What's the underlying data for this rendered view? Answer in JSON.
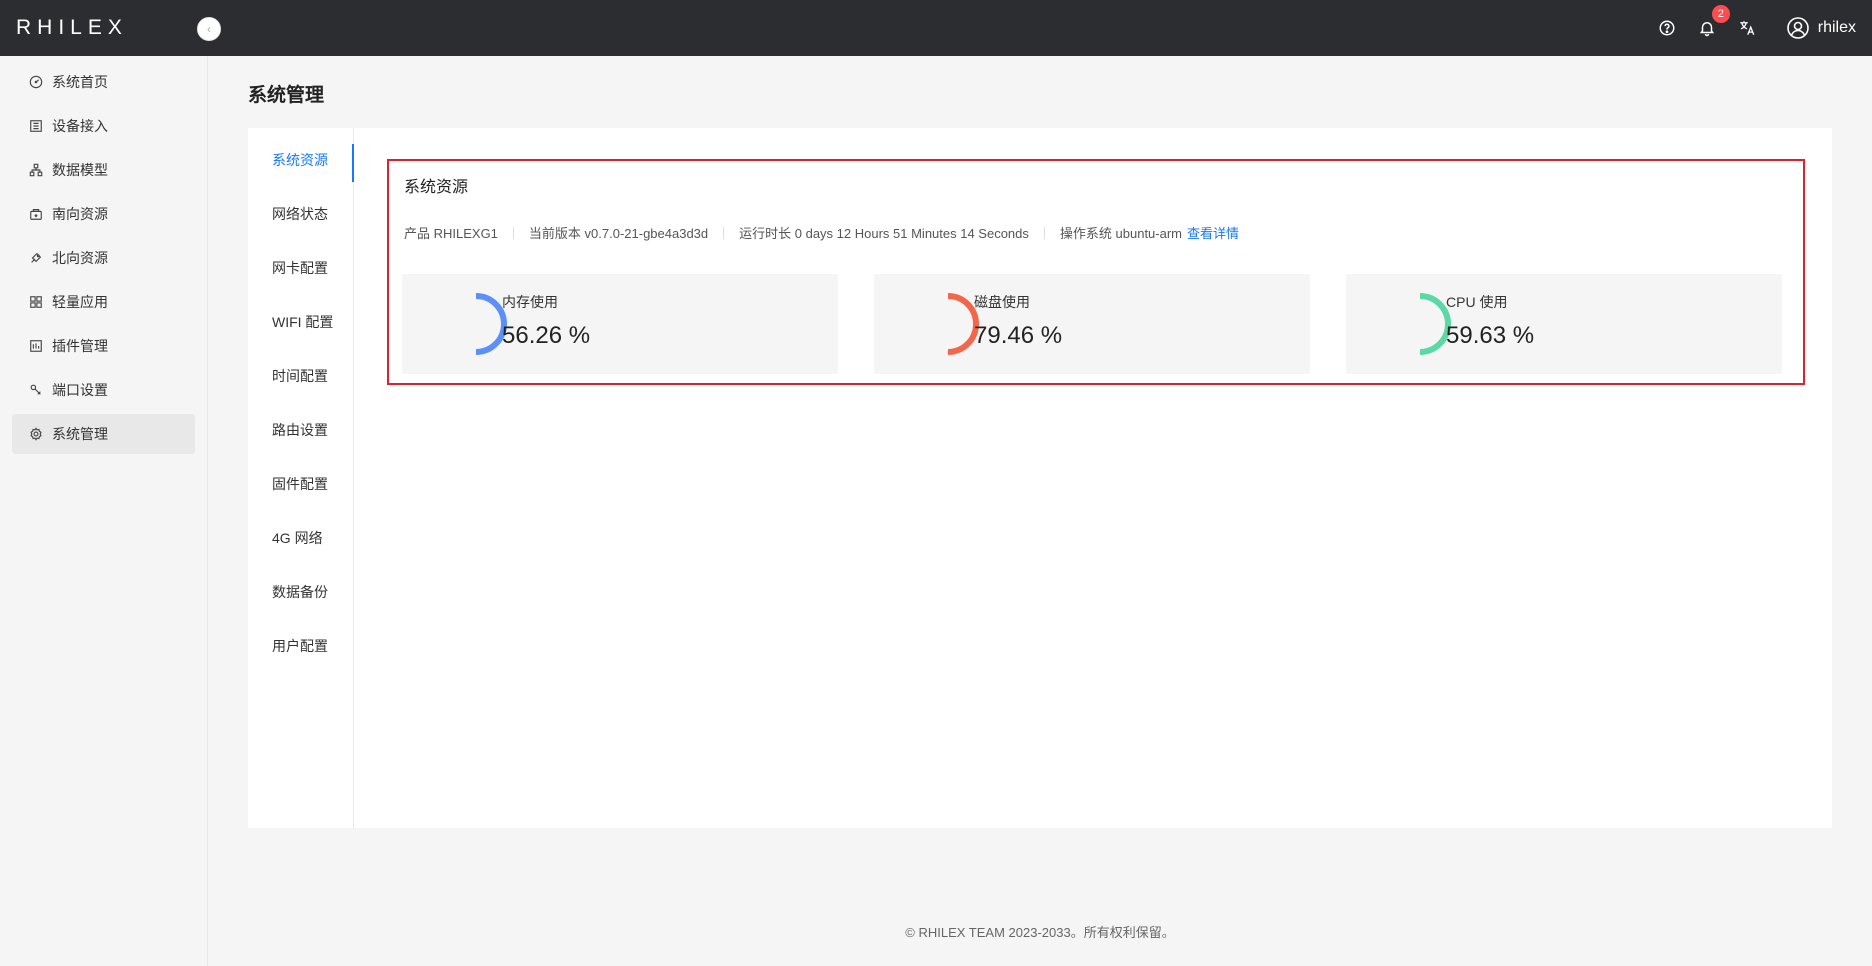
{
  "header": {
    "logo": "RHILEX",
    "notification_count": "2",
    "username": "rhilex"
  },
  "sidebar": {
    "items": [
      {
        "label": "系统首页",
        "icon": "dashboard-icon"
      },
      {
        "label": "设备接入",
        "icon": "device-icon"
      },
      {
        "label": "数据模型",
        "icon": "model-icon"
      },
      {
        "label": "南向资源",
        "icon": "south-icon"
      },
      {
        "label": "北向资源",
        "icon": "north-icon"
      },
      {
        "label": "轻量应用",
        "icon": "app-icon"
      },
      {
        "label": "插件管理",
        "icon": "plugin-icon"
      },
      {
        "label": "端口设置",
        "icon": "port-icon"
      },
      {
        "label": "系统管理",
        "icon": "gear-icon",
        "active": true
      }
    ]
  },
  "page": {
    "title": "系统管理"
  },
  "subnav": {
    "items": [
      "系统资源",
      "网络状态",
      "网卡配置",
      "WIFI 配置",
      "时间配置",
      "路由设置",
      "固件配置",
      "4G  网络",
      "数据备份",
      "用户配置"
    ],
    "active": 0
  },
  "resources": {
    "title": "系统资源",
    "product_label": "产品 RHILEXG1",
    "version_label": "当前版本 v0.7.0-21-gbe4a3d3d",
    "uptime_label": "运行时长 0 days 12 Hours 51 Minutes 14 Seconds",
    "os_label": "操作系统 ubuntu-arm",
    "details_link": "查看详情",
    "stats": [
      {
        "label": "内存使用",
        "value": "56.26 %",
        "percent": 56.26,
        "color": "#5b8ff9"
      },
      {
        "label": "磁盘使用",
        "value": "79.46 %",
        "percent": 79.46,
        "color": "#f4664a"
      },
      {
        "label": "CPU 使用",
        "value": "59.63 %",
        "percent": 59.63,
        "color": "#5ad8a6"
      }
    ]
  },
  "footer": {
    "copyright": "© RHILEX TEAM 2023-2033。所有权利保留。"
  }
}
